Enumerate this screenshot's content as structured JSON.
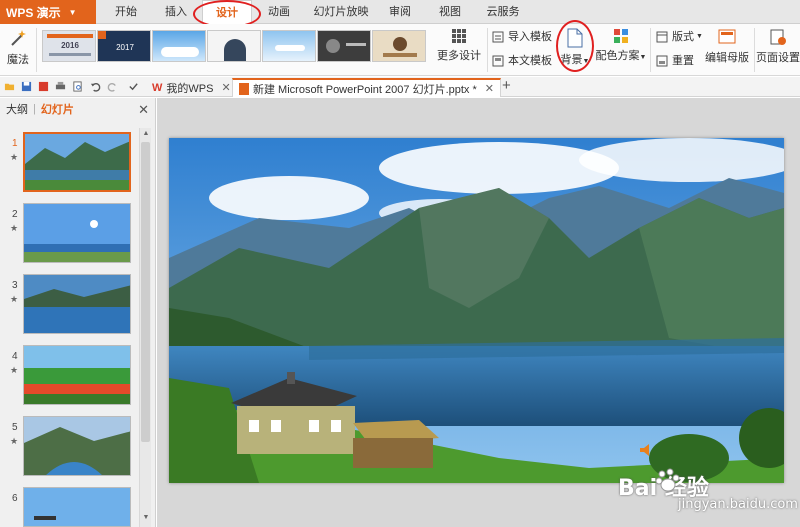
{
  "app": {
    "name": "WPS 演示"
  },
  "menu": {
    "tabs": [
      {
        "label": "开始"
      },
      {
        "label": "插入"
      },
      {
        "label": "设计"
      },
      {
        "label": "动画"
      },
      {
        "label": "幻灯片放映"
      },
      {
        "label": "审阅"
      },
      {
        "label": "视图"
      },
      {
        "label": "云服务"
      }
    ],
    "active_tab": "设计"
  },
  "ribbon": {
    "magic_label": "魔法",
    "template_thumbs": [
      {
        "text": "2016"
      },
      {
        "text": "2017"
      },
      {
        "text": ""
      },
      {
        "text": ""
      },
      {
        "text": ""
      },
      {
        "text": ""
      },
      {
        "text": ""
      }
    ],
    "more_designs_label": "更多设计",
    "import_template_label": "导入模板",
    "this_doc_template_label": "本文模板",
    "background_label": "背景",
    "color_scheme_label": "配色方案",
    "layout_label": "版式",
    "reset_label": "重置",
    "edit_master_label": "编辑母版",
    "page_setup_label": "页面设置"
  },
  "doc_tabs": [
    {
      "label": "我的WPS"
    },
    {
      "label": "新建 Microsoft PowerPoint 2007 幻灯片.pptx *"
    }
  ],
  "left_panel": {
    "outline_label": "大纲",
    "slides_label": "幻灯片",
    "slides": [
      {
        "num": "1",
        "star": "★"
      },
      {
        "num": "2",
        "star": "★"
      },
      {
        "num": "3",
        "star": "★"
      },
      {
        "num": "4",
        "star": "★"
      },
      {
        "num": "5",
        "star": "★"
      },
      {
        "num": "6",
        "star": ""
      }
    ],
    "selected_slide": 1
  },
  "watermark": {
    "brand": "Bai  经验",
    "url": "jingyan.baidu.com"
  },
  "colors": {
    "accent": "#e2641c",
    "annotation": "#e02020"
  }
}
